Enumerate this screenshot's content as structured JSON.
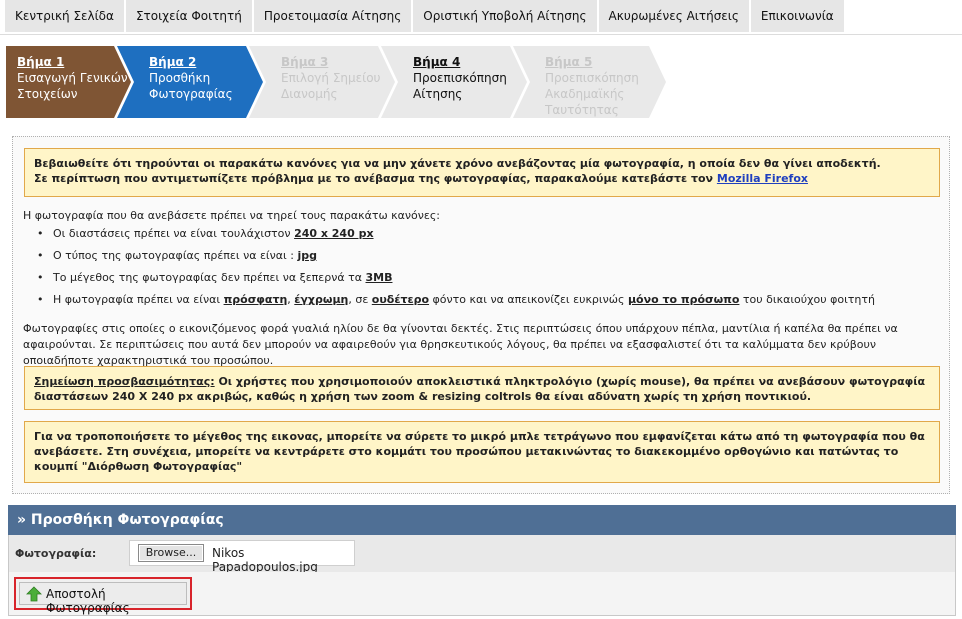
{
  "nav": {
    "items": [
      "Κεντρική Σελίδα",
      "Στοιχεία Φοιτητή",
      "Προετοιμασία Αίτησης",
      "Οριστική Υποβολή Αίτησης",
      "Ακυρωμένες Αιτήσεις",
      "Επικοινωνία"
    ]
  },
  "steps": [
    {
      "title": "Βήμα 1",
      "line1": "Εισαγωγή Γενικών",
      "line2": "Στοιχείων",
      "line3": "",
      "state": "done",
      "color": "#7f5534"
    },
    {
      "title": "Βήμα 2",
      "line1": "Προσθήκη",
      "line2": "Φωτογραφίας",
      "line3": "",
      "state": "active",
      "color": "#1e6fc0"
    },
    {
      "title": "Βήμα 3",
      "line1": "Επιλογή Σημείου",
      "line2": "Διανομής",
      "line3": "",
      "state": "disabled",
      "color": "#e9e9e9"
    },
    {
      "title": "Βήμα 4",
      "line1": "Προεπισκόπηση",
      "line2": "Αίτησης",
      "line3": "",
      "state": "enabled",
      "color": "#e9e9e9"
    },
    {
      "title": "Βήμα 5",
      "line1": "Προεπισκόπηση",
      "line2": "Ακαδημαϊκής",
      "line3": "Ταυτότητας",
      "state": "disabled",
      "color": "#e9e9e9"
    }
  ],
  "notice": {
    "line1": "Βεβαιωθείτε ότι τηρούνται οι παρακάτω κανόνες για να μην χάνετε χρόνο ανεβάζοντας μία φωτογραφία, η οποία δεν θα γίνει αποδεκτή.",
    "line2": "Σε περίπτωση που αντιμετωπίζετε πρόβλημα με το ανέβασμα της φωτογραφίας, παρακαλούμε κατεβάστε τον ",
    "link": "Mozilla Firefox"
  },
  "rules": {
    "intro": "Η φωτογραφία που θα ανεβάσετε πρέπει να τηρεί τους παρακάτω κανόνες:",
    "r1_text": "Οι διαστάσεις πρέπει να είναι τουλάχιστον ",
    "r1_bold": "240 x 240 px",
    "r2_text": "Ο τύπος της φωτογραφίας πρέπει να είναι : ",
    "r2_bold": "jpg",
    "r3_text": "Το μέγεθος της φωτογραφίας δεν πρέπει να ξεπερνά τα ",
    "r3_bold": "3MB",
    "r4_a": "Η φωτογραφία πρέπει να είναι ",
    "r4_b": "πρόσφατη",
    "r4_c": ", ",
    "r4_d": "έγχρωμη",
    "r4_e": ", σε ",
    "r4_f": "ουδέτερο",
    "r4_g": " φόντο και να απεικονίζει ευκρινώς ",
    "r4_h": "μόνο το πρόσωπο",
    "r4_i": " του δικαιούχου φοιτητή"
  },
  "glasses_paragraph": "Φωτογραφίες στις οποίες ο εικονιζόμενος φορά γυαλιά ηλίου δε θα γίνονται δεκτές. Στις περιπτώσεις όπου υπάρχουν πέπλα, μαντίλια ή καπέλα θα πρέπει να αφαιρούνται. Σε περιπτώσεις που αυτά δεν μπορούν να αφαιρεθούν για θρησκευτικούς λόγους, θα πρέπει να εξασφαλιστεί ότι τα καλύμματα δεν κρύβουν οποιαδήποτε χαρακτηριστικά του προσώπου.",
  "accessibility_note": {
    "label": "Σημείωση προσβασιμότητας:",
    "text": " Οι χρήστες που χρησιμοποιούν αποκλειστικά πληκτρολόγιο (χωρίς mouse), θα πρέπει να ανεβάσουν φωτογραφία διαστάσεων 240 X 240 px ακριβώς, καθώς η χρήση των zoom & resizing coltrols θα είναι αδύνατη χωρίς τη χρήση ποντικιού."
  },
  "resize_note": "Για να τροποποιήσετε το μέγεθος της εικονας, μπορείτε να σύρετε το μικρό μπλε τετράγωνο που εμφανίζεται κάτω από τη φωτογραφία που θα ανεβάσετε. Στη συνέχεια, μπορείτε να κεντράρετε στο κομμάτι του προσώπου μετακινώντας το διακεκομμένο ορθογώνιο και πατώντας το κουμπί \"Διόρθωση Φωτογραφίας\"",
  "upload": {
    "header": "» Προσθήκη Φωτογραφίας",
    "label": "Φωτογραφία:",
    "browse_label": "Browse...",
    "file_name": "Nikos Papadopoulos.jpg",
    "submit_label": "Αποστολή Φωτογραφίας"
  },
  "colors": {
    "step_done": "#7f5534",
    "step_active": "#1e6fc0",
    "header_bg": "#4f6f95",
    "note_bg": "#fff5c8",
    "note_border": "#e1a84a",
    "highlight_border": "#d8242b"
  },
  "icons": {
    "submit": "green-up-arrow-icon"
  }
}
